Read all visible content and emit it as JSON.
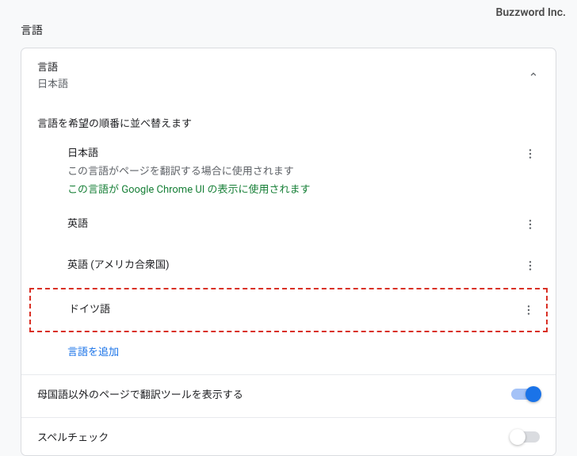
{
  "brand": "Buzzword Inc.",
  "pageTitle": "言語",
  "card": {
    "title": "言語",
    "current": "日本語",
    "sectionLabel": "言語を希望の順番に並べ替えます",
    "languages": [
      {
        "name": "日本語",
        "desc": "この言語がページを翻訳する場合に使用されます",
        "note": "この言語が Google Chrome UI の表示に使用されます",
        "highlighted": false
      },
      {
        "name": "英語",
        "desc": "",
        "note": "",
        "highlighted": false
      },
      {
        "name": "英語 (アメリカ合衆国)",
        "desc": "",
        "note": "",
        "highlighted": false
      },
      {
        "name": "ドイツ語",
        "desc": "",
        "note": "",
        "highlighted": true
      }
    ],
    "addLanguage": "言語を追加",
    "translateRow": "母国語以外のページで翻訳ツールを表示する",
    "translateOn": true,
    "spellcheckRow": "スペルチェック",
    "spellcheckOn": false
  },
  "colors": {
    "accent": "#1a73e8",
    "green": "#188038",
    "red": "#d93025"
  }
}
